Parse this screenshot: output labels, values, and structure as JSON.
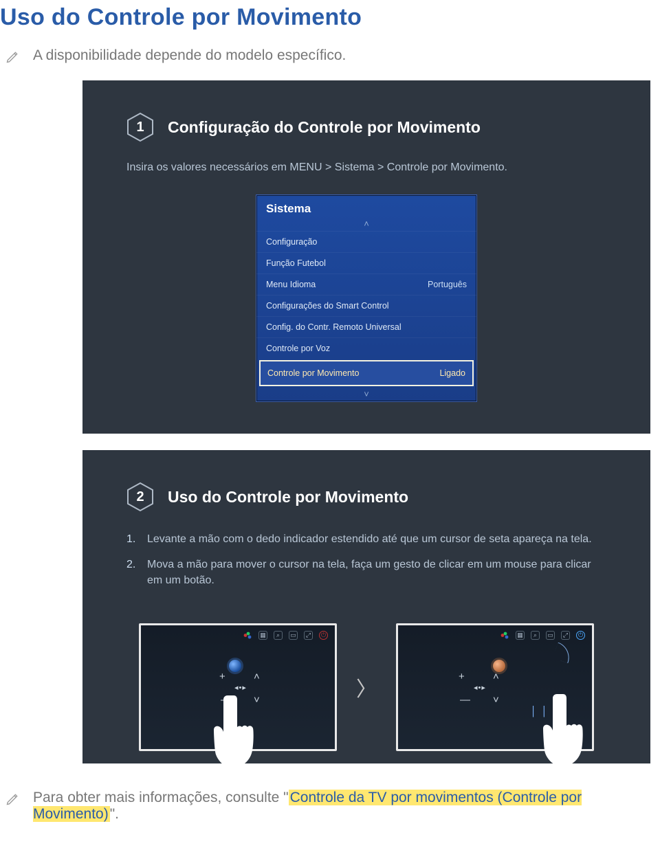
{
  "page": {
    "title": "Uso do Controle por Movimento"
  },
  "notes": {
    "top": "A disponibilidade depende do modelo específico.",
    "footer_pre": "Para obter mais informações, consulte \"",
    "footer_link": "Controle da TV por movimentos (Controle por Movimento)",
    "footer_post": "\"."
  },
  "panel1": {
    "badge": "1",
    "heading": "Configuração do Controle por Movimento",
    "subhead": "Insira os valores necessários em MENU > Sistema > Controle por Movimento.",
    "menu_title": "Sistema",
    "menu_items": [
      {
        "label": "Configuração",
        "value": ""
      },
      {
        "label": "Função Futebol",
        "value": ""
      },
      {
        "label": "Menu Idioma",
        "value": "Português"
      },
      {
        "label": "Configurações do Smart Control",
        "value": ""
      },
      {
        "label": "Config. do Contr. Remoto Universal",
        "value": ""
      },
      {
        "label": "Controle por Voz",
        "value": ""
      }
    ],
    "menu_selected": {
      "label": "Controle por Movimento",
      "value": "Ligado"
    }
  },
  "panel2": {
    "badge": "2",
    "heading": "Uso do Controle por Movimento",
    "steps": [
      "Levante a mão com o dedo indicador estendido até que um cursor de seta apareça na tela.",
      "Mova a mão para mover o cursor na tela, faça um gesto de clicar em um mouse para clicar em um botão."
    ],
    "toolbar_icons": [
      "smart-hub-icon",
      "grid-icon",
      "search-icon",
      "pip-icon",
      "expand-icon",
      "power-icon"
    ],
    "dpad": {
      "plus": "+",
      "minus": "—",
      "up": "˄",
      "down": "˅",
      "speaker": "◂•▸"
    }
  }
}
